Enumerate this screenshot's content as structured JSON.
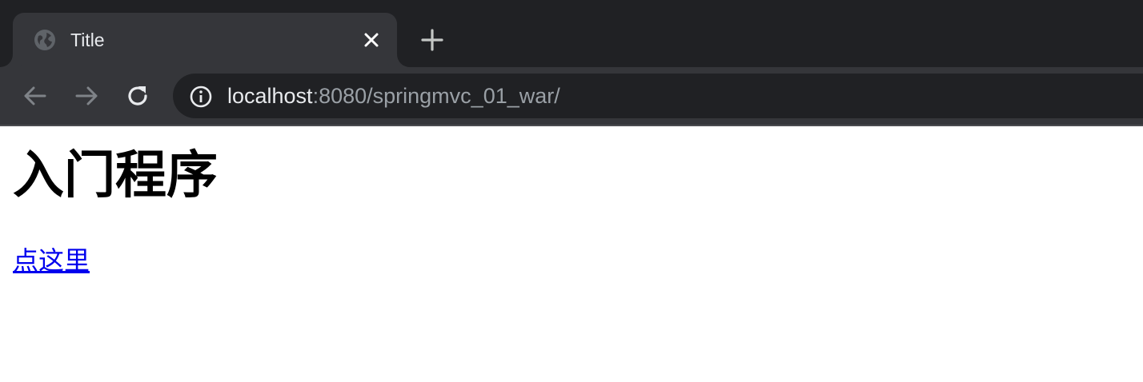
{
  "tab": {
    "title": "Title",
    "favicon": "globe-icon",
    "close": "close-icon"
  },
  "new_tab": "plus-icon",
  "navigation": {
    "back": "arrow-left-icon",
    "forward": "arrow-right-icon",
    "reload": "reload-icon"
  },
  "address_bar": {
    "security_icon": "info-icon",
    "host": "localhost",
    "rest": ":8080/springmvc_01_war/"
  },
  "page": {
    "heading": "入门程序",
    "link_text": "点这里"
  },
  "colors": {
    "tab_strip": "#202124",
    "toolbar": "#35363a",
    "omnibox": "#202124",
    "link": "#0000ee"
  }
}
